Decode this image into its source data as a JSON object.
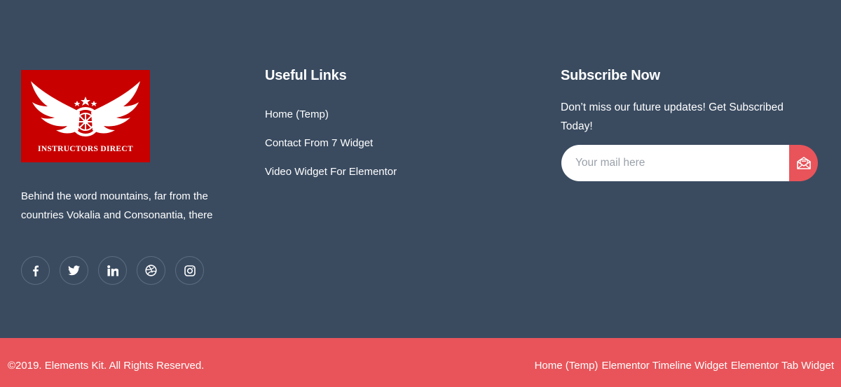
{
  "logo": {
    "text": "INSTRUCTORS DIRECT",
    "bg_color": "#c80000"
  },
  "about": {
    "text": "Behind the word mountains, far from the countries Vokalia and Consonantia, there"
  },
  "social": [
    {
      "icon": "facebook-icon"
    },
    {
      "icon": "twitter-icon"
    },
    {
      "icon": "linkedin-icon"
    },
    {
      "icon": "dribbble-icon"
    },
    {
      "icon": "instagram-icon"
    }
  ],
  "useful_links": {
    "heading": "Useful Links",
    "items": [
      {
        "label": "Home (Temp)"
      },
      {
        "label": "Contact From 7 Widget"
      },
      {
        "label": "Video Widget For Elementor"
      }
    ]
  },
  "subscribe": {
    "heading": "Subscribe Now",
    "text": "Don’t miss our future updates! Get Subscribed Today!",
    "placeholder": "Your mail here",
    "button_icon": "envelope-open-icon"
  },
  "bottom": {
    "copyright": "©2019. Elements Kit. All Rights Reserved.",
    "links": [
      {
        "label": "Home (Temp)"
      },
      {
        "label": "Elementor Timeline Widget"
      },
      {
        "label": "Elementor Tab Widget"
      }
    ]
  },
  "colors": {
    "footer_bg": "#3a4b60",
    "accent": "#e8545a",
    "text": "#ffffff"
  }
}
